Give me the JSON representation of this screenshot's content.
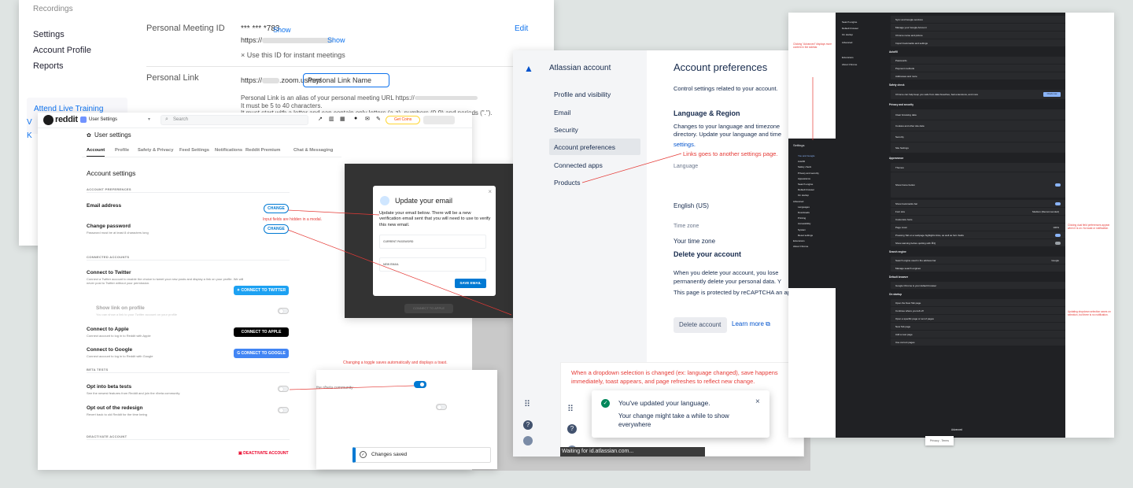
{
  "zoom": {
    "sidebar": [
      "Recordings",
      "Settings",
      "Account Profile",
      "Reports"
    ],
    "attend_live_training": "Attend Live Training",
    "pmi": {
      "label": "Personal Meeting ID",
      "value": "*** *** *783",
      "show": "Show",
      "url_prefix": "https://",
      "show2": "Show",
      "use_for_instant": "× Use this ID for instant meetings",
      "edit": "Edit"
    },
    "personal_link": {
      "label": "Personal Link",
      "url": "https://",
      "domain": ".zoom.us/my/",
      "placeholder": "Personal Link Name",
      "desc": "Personal Link is an alias of your personal meeting URL https://",
      "rule1": "It must be 5 to 40 characters.",
      "rule2": "It must start with a letter and can contain only letters (a-z), numbers (0-9) and periods (\".\")."
    }
  },
  "reddit": {
    "logo": "reddit",
    "community": "User Settings",
    "search_placeholder": "Search",
    "get_coins": "Get Coins",
    "page_title": "User settings",
    "tabs": [
      "Account",
      "Profile",
      "Safety & Privacy",
      "Feed Settings",
      "Notifications",
      "Reddit Premium",
      "Chat & Messaging"
    ],
    "heading": "Account settings",
    "account_prefs": "ACCOUNT PREFERENCES",
    "email_label": "Email address",
    "change": "CHANGE",
    "password_label": "Change password",
    "password_sub": "Password must be at least 8 characters long",
    "connected": "CONNECTED ACCOUNTS",
    "twitter_title": "Connect to Twitter",
    "twitter_sub": "Connect a Twitter account to enable the choice to tweet your new posts and display a link on your profile. We will never post to Twitter without your permission.",
    "twitter_btn": "CONNECT TO TWITTER",
    "show_link": "Show link on profile",
    "show_link_sub": "You can show a link to your Twitter account on your profile",
    "apple_title": "Connect to Apple",
    "apple_sub": "Connect account to log in to Reddit with Apple",
    "apple_btn": "CONNECT TO APPLE",
    "google_title": "Connect to Google",
    "google_sub": "Connect account to log in to Reddit with Google",
    "google_btn": "CONNECT TO GOOGLE",
    "beta": "BETA TESTS",
    "beta_title": "Opt into beta tests",
    "beta_sub": "See the newest features from Reddit and join the r/beta community",
    "redesign_title": "Opt out of the redesign",
    "redesign_sub": "Revert back to old Reddit for the time being",
    "deactivate_head": "DEACTIVATE ACCOUNT",
    "deactivate": "DEACTIVATE ACCOUNT"
  },
  "modal": {
    "title": "Update your email",
    "body": "Update your email below. There will be a new verification email sent that you will need to use to verify this new email.",
    "current_pw": "CURRENT PASSWORD",
    "new_email": "NEW EMAIL",
    "save": "SAVE EMAIL",
    "behind_btn": "CONNECT TO APPLE"
  },
  "toast_reddit": {
    "community": "the r/beta community",
    "saved": "Changes saved"
  },
  "atlassian": {
    "brand": "Atlassian account",
    "nav": [
      "Profile and visibility",
      "Email",
      "Security",
      "Account preferences",
      "Connected apps",
      "Products"
    ],
    "title": "Account preferences",
    "intro": "Control settings related to your account.",
    "lang_head": "Language & Region",
    "lang_desc": "Changes to your language and timezone directory. Update your language and time",
    "settings_link": "settings.",
    "language_label": "Language",
    "language_value": "English (US)",
    "tz_label": "Time zone",
    "tz_value": "Your time zone",
    "delete_head": "Delete your account",
    "delete_desc": "When you delete your account, you lose permanently delete your personal data. Y",
    "recaptcha": "This page is protected by reCAPTCHA an apply.",
    "delete_btn": "Delete account",
    "learn_more": "Learn more",
    "toast_title": "You've updated your language.",
    "toast_body": "Your change might take a while to show everywhere",
    "status": "Waiting for id.atlassian.com..."
  },
  "chrome": {
    "settings": "Settings",
    "menu": [
      "You and Google",
      "Autofill",
      "Safety check",
      "Privacy and security",
      "Appearance",
      "Search engine",
      "Default browser",
      "On startup"
    ],
    "advanced": "Advanced",
    "adv_items": [
      "Languages",
      "Downloads",
      "Printing",
      "Accessibility",
      "System",
      "Reset settings"
    ],
    "extensions": "Extensions",
    "about": "About Chrome",
    "top_rows": [
      "Sync and Google services",
      "Manage your Google Account",
      "Chrome name and picture",
      "Import bookmarks and settings"
    ],
    "autofill_head": "Autofill",
    "autofill_rows": [
      "Passwords",
      "Payment methods",
      "Addresses and more"
    ],
    "safety_head": "Safety check",
    "safety_row": "Chrome can help keep you safe from data breaches, bad extensions, and more",
    "check_now": "Check now",
    "privacy_head": "Privacy and security",
    "privacy_rows": [
      "Clear browsing data",
      "Cookies and other site data",
      "Security",
      "Site Settings"
    ],
    "appearance_head": "Appearance",
    "appearance_rows": [
      "Themes",
      "Show home button",
      "New Tab page",
      "Show bookmarks bar",
      "Font size",
      "Customize fonts",
      "Page zoom",
      "Pressing Tab on a webpage highlights links, as well as form fields",
      "Show warning before quitting with ⌘Q"
    ],
    "font_size": "Medium (Recommended)",
    "zoom": "100%",
    "search_head": "Search engine",
    "search_row": "Search engine used in the address bar",
    "search_value": "Google",
    "manage_search": "Manage search engines",
    "default_head": "Default browser",
    "default_row": "Google Chrome is your default browser",
    "startup_head": "On startup",
    "startup_rows": [
      "Open the New Tab page",
      "Continue where you left off",
      "Open a specific page or set of pages"
    ],
    "add_page": "Add a new page",
    "use_current": "Use current pages",
    "advanced_footer": "Advanced",
    "recaptcha": "Privacy - Terms"
  },
  "notes": {
    "input_hidden": "Input fields are hidden in a modal.",
    "toggle_toast": "Changing a toggle saves automatically and displays a toast.",
    "links_goes": "Links goes to another settings page.",
    "dropdown": "When a dropdown selection is changed (ex: language changed), save happens immediately, toast appears, and page refreshes to reflect new change.",
    "chrome_left": "Clicking \"Advanced\" displays more content in the sidebar.",
    "chrome_right1": "Clicking dual field preferences appear when it is on. No toast or notification.",
    "chrome_right2": "Updating dropdown selection saves on selection, but there is no notification."
  }
}
